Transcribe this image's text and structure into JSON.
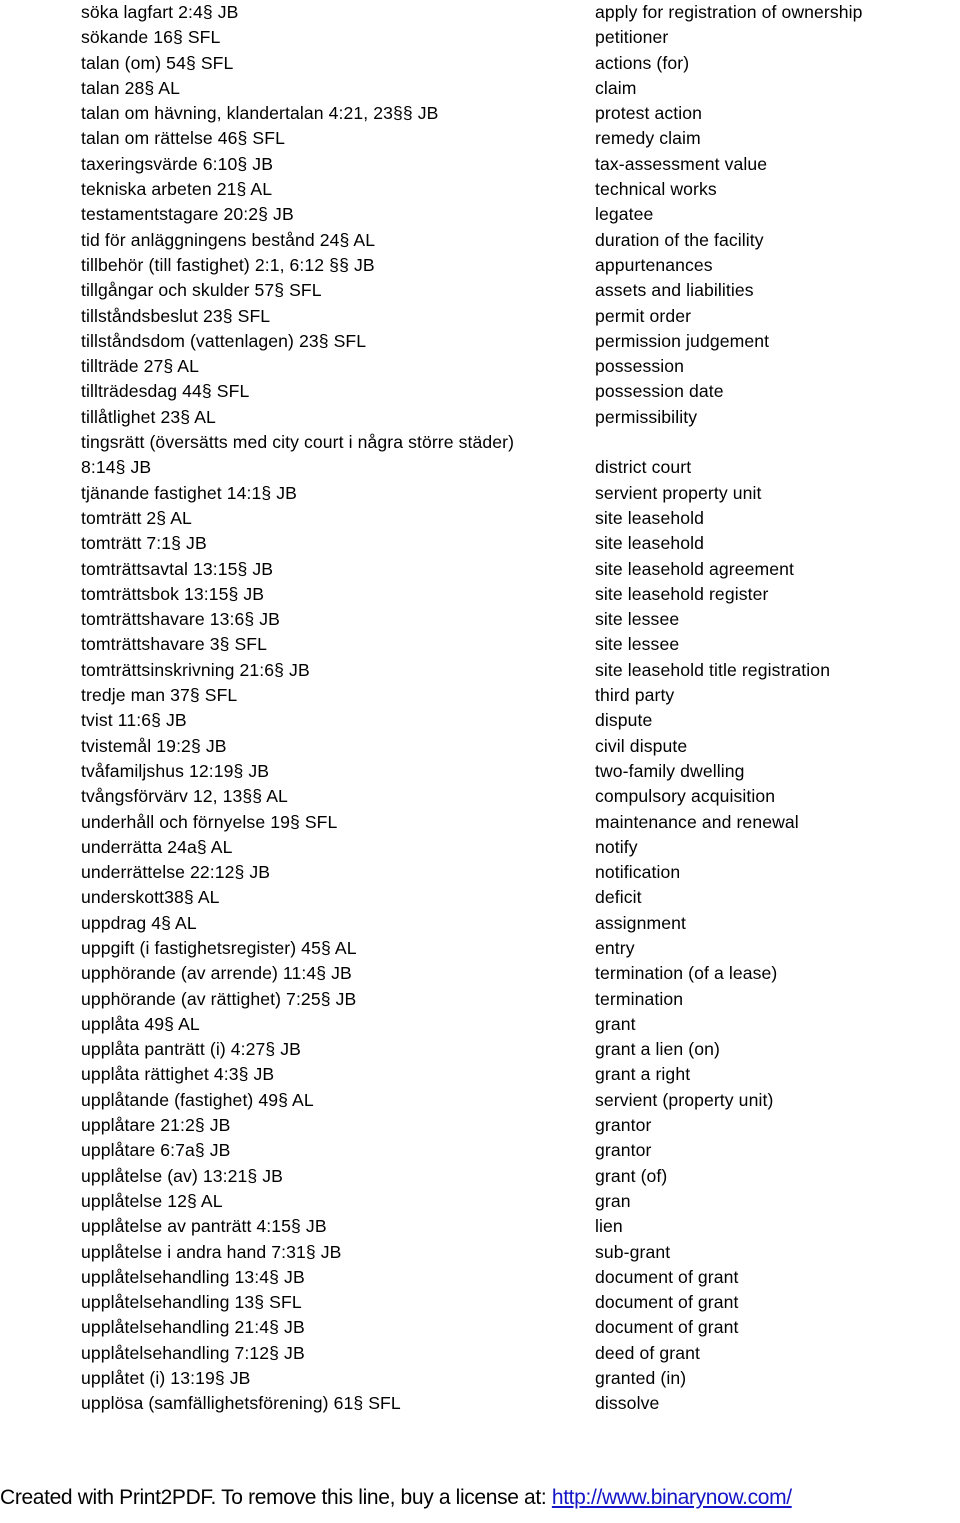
{
  "document": {
    "type": "bilingual-glossary",
    "language_pair": "Swedish-English",
    "columns": [
      "swedish_term",
      "english_gloss"
    ]
  },
  "entries": [
    {
      "term": "söka lagfart 2:4§ JB",
      "gloss": "apply for registration of ownership"
    },
    {
      "term": "sökande 16§ SFL",
      "gloss": "petitioner"
    },
    {
      "term": "talan (om) 54§ SFL",
      "gloss": "actions (for)"
    },
    {
      "term": "talan 28§ AL",
      "gloss": "claim"
    },
    {
      "term": "talan om hävning, klandertalan 4:21, 23§§ JB",
      "gloss": "protest action"
    },
    {
      "term": "talan om rättelse 46§ SFL",
      "gloss": "remedy claim"
    },
    {
      "term": "taxeringsvärde 6:10§ JB",
      "gloss": "tax-assessment value"
    },
    {
      "term": "tekniska arbeten 21§ AL",
      "gloss": "technical works"
    },
    {
      "term": "testamentstagare 20:2§ JB",
      "gloss": "legatee"
    },
    {
      "term": "tid för anläggningens bestånd 24§ AL",
      "gloss": "duration of the facility"
    },
    {
      "term": "tillbehör (till fastighet) 2:1, 6:12 §§ JB",
      "gloss": "appurtenances"
    },
    {
      "term": "tillgångar och skulder 57§ SFL",
      "gloss": "assets and liabilities"
    },
    {
      "term": "tillståndsbeslut 23§ SFL",
      "gloss": "permit order"
    },
    {
      "term": "tillståndsdom (vattenlagen) 23§ SFL",
      "gloss": "permission judgement"
    },
    {
      "term": "tillträde 27§ AL",
      "gloss": "possession"
    },
    {
      "term": "tillträdesdag 44§ SFL",
      "gloss": "possession date"
    },
    {
      "term": "tillåtlighet 23§ AL",
      "gloss": "permissibility"
    },
    {
      "term": "tingsrätt (översätts med city court i några större städer)",
      "gloss": ""
    },
    {
      "term": "8:14§ JB",
      "gloss": "district court"
    },
    {
      "term": "tjänande fastighet 14:1§ JB",
      "gloss": "servient property unit"
    },
    {
      "term": "tomträtt 2§ AL",
      "gloss": "site leasehold"
    },
    {
      "term": "tomträtt 7:1§ JB",
      "gloss": "site leasehold"
    },
    {
      "term": "tomträttsavtal 13:15§ JB",
      "gloss": "site leasehold agreement"
    },
    {
      "term": "tomträttsbok 13:15§ JB",
      "gloss": "site leasehold register"
    },
    {
      "term": "tomträttshavare 13:6§ JB",
      "gloss": "site lessee"
    },
    {
      "term": "tomträttshavare 3§ SFL",
      "gloss": "site lessee"
    },
    {
      "term": "tomträttsinskrivning 21:6§ JB",
      "gloss": "site leasehold title registration"
    },
    {
      "term": "tredje man 37§ SFL",
      "gloss": "third party"
    },
    {
      "term": "tvist 11:6§ JB",
      "gloss": "dispute"
    },
    {
      "term": "tvistemål 19:2§ JB",
      "gloss": "civil dispute"
    },
    {
      "term": "tvåfamiljshus 12:19§ JB",
      "gloss": "two-family dwelling"
    },
    {
      "term": "tvångsförvärv 12, 13§§ AL",
      "gloss": "compulsory acquisition"
    },
    {
      "term": "underhåll och förnyelse 19§ SFL",
      "gloss": "maintenance and renewal"
    },
    {
      "term": "underrätta 24a§ AL",
      "gloss": "notify"
    },
    {
      "term": "underrättelse 22:12§ JB",
      "gloss": "notification"
    },
    {
      "term": "underskott38§ AL",
      "gloss": "deficit"
    },
    {
      "term": "uppdrag 4§ AL",
      "gloss": "assignment"
    },
    {
      "term": "uppgift (i fastighetsregister) 45§ AL",
      "gloss": "entry"
    },
    {
      "term": "upphörande (av arrende) 11:4§ JB",
      "gloss": "termination (of a lease)"
    },
    {
      "term": "upphörande (av rättighet) 7:25§ JB",
      "gloss": "termination"
    },
    {
      "term": "upplåta 49§ AL",
      "gloss": "grant"
    },
    {
      "term": "upplåta panträtt (i) 4:27§ JB",
      "gloss": "grant a lien (on)"
    },
    {
      "term": "upplåta rättighet 4:3§ JB",
      "gloss": "grant a right"
    },
    {
      "term": "upplåtande (fastighet) 49§ AL",
      "gloss": "servient (property unit)"
    },
    {
      "term": "upplåtare 21:2§ JB",
      "gloss": "grantor"
    },
    {
      "term": "upplåtare 6:7a§ JB",
      "gloss": "grantor"
    },
    {
      "term": "upplåtelse (av) 13:21§ JB",
      "gloss": "grant (of)"
    },
    {
      "term": "upplåtelse 12§ AL",
      "gloss": "gran"
    },
    {
      "term": "upplåtelse av panträtt 4:15§ JB",
      "gloss": "lien"
    },
    {
      "term": "upplåtelse i andra hand 7:31§ JB",
      "gloss": "sub-grant"
    },
    {
      "term": "upplåtelsehandling 13:4§ JB",
      "gloss": "document of grant"
    },
    {
      "term": "upplåtelsehandling 13§ SFL",
      "gloss": "document of grant"
    },
    {
      "term": "upplåtelsehandling 21:4§ JB",
      "gloss": "document of grant"
    },
    {
      "term": "upplåtelsehandling 7:12§ JB",
      "gloss": "deed of grant"
    },
    {
      "term": "upplåtet (i) 13:19§ JB",
      "gloss": "granted (in)"
    },
    {
      "term": "upplösa (samfällighetsförening) 61§ SFL",
      "gloss": "dissolve"
    }
  ],
  "footer": {
    "text": "Created with Print2PDF. To remove this line, buy a license at:",
    "url": "http://www.binarynow.com/",
    "link_color": "#1414c8"
  }
}
